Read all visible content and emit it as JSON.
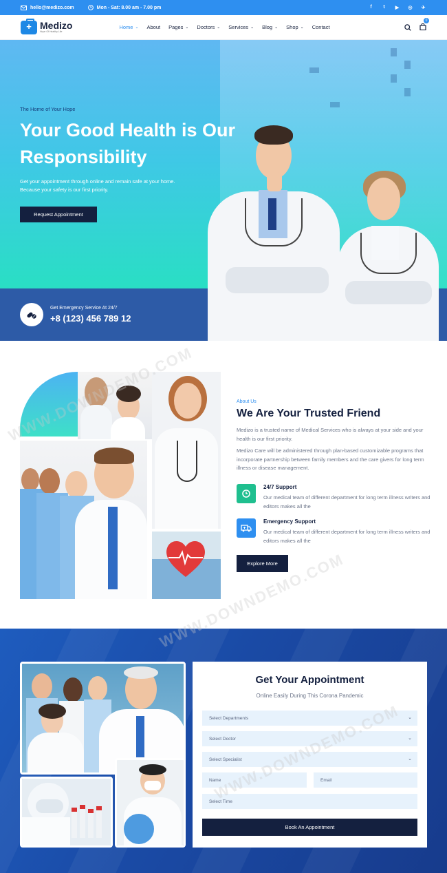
{
  "topbar": {
    "email": "hello@medizo.com",
    "hours": "Mon - Sat: 8.00 am - 7.00 pm",
    "socials": [
      "f",
      "t",
      "▶",
      "◎",
      "✈"
    ]
  },
  "brand": {
    "name": "Medizo",
    "tagline": "Hope Of Healthy Life"
  },
  "nav": {
    "items": [
      {
        "label": "Home",
        "dropdown": true,
        "active": true
      },
      {
        "label": "About",
        "dropdown": false
      },
      {
        "label": "Pages",
        "dropdown": true
      },
      {
        "label": "Doctors",
        "dropdown": true
      },
      {
        "label": "Services",
        "dropdown": true
      },
      {
        "label": "Blog",
        "dropdown": true
      },
      {
        "label": "Shop",
        "dropdown": true
      },
      {
        "label": "Contact",
        "dropdown": false
      }
    ],
    "cart_count": "0"
  },
  "hero": {
    "tagline": "The Home of Your Hope",
    "title": "Your Good Health is Our Responsibility",
    "text": "Get your appointment through online and remain safe at your home. Because your safety is our first priority.",
    "button": "Request Appointment",
    "emergency_label": "Get Emergency Service At 24/7",
    "emergency_phone": "+8 (123) 456 789 12"
  },
  "about": {
    "tag": "About Us",
    "title": "We Are Your Trusted Friend",
    "p1": "Medizo is a trusted name of Medical Services who is always at your side and your health is our first priority.",
    "p2": "Medizo Care will be administered through plan-based customizable programs that incorporate partnership between family members and the care givers for long term illness or disease management.",
    "features": [
      {
        "title": "24/7 Support",
        "text": "Our medical team of different department for long term illness writers and editors makes all the"
      },
      {
        "title": "Emergency Support",
        "text": "Our medical team of different department for long term illness writers and editors makes all the"
      }
    ],
    "button": "Explore More"
  },
  "appointment": {
    "title": "Get Your Appointment",
    "subtitle": "Online Easily During This Corona Pandemic",
    "fields": {
      "department": "Select Departments",
      "doctor": "Select Doctor",
      "specialist": "Select Specialist",
      "name": "Name",
      "email": "Email",
      "time": "Select Time"
    },
    "button": "Book An Appointment"
  },
  "watermark": "WWW.DOWNDEMO.COM",
  "colors": {
    "primary": "#2e8ff0",
    "dark": "#14203f",
    "teal": "#28e0c2",
    "band": "#2d5ba7",
    "feature_green": "#1fbf8f",
    "feature_blue": "#2e8ff0"
  }
}
